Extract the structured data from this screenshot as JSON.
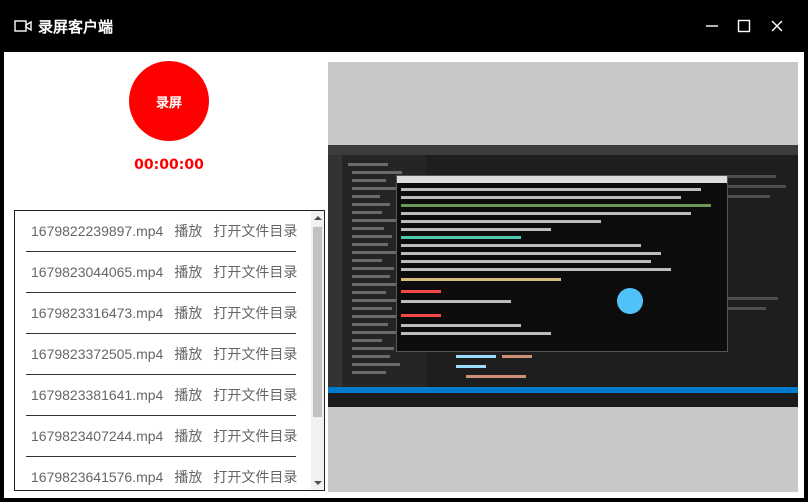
{
  "window": {
    "title": "录屏客户端"
  },
  "recorder": {
    "record_label": "录屏",
    "timer": "00:00:00"
  },
  "recordings": [
    {
      "filename": "1679822239897.mp4",
      "play": "播放",
      "open_folder": "打开文件目录"
    },
    {
      "filename": "1679823044065.mp4",
      "play": "播放",
      "open_folder": "打开文件目录"
    },
    {
      "filename": "1679823316473.mp4",
      "play": "播放",
      "open_folder": "打开文件目录"
    },
    {
      "filename": "1679823372505.mp4",
      "play": "播放",
      "open_folder": "打开文件目录"
    },
    {
      "filename": "1679823381641.mp4",
      "play": "播放",
      "open_folder": "打开文件目录"
    },
    {
      "filename": "1679823407244.mp4",
      "play": "播放",
      "open_folder": "打开文件目录"
    },
    {
      "filename": "1679823641576.mp4",
      "play": "播放",
      "open_folder": "打开文件目录"
    }
  ],
  "icons": {
    "app": "video-camera-icon",
    "minimize": "minimize-icon",
    "maximize": "maximize-icon",
    "close": "close-icon",
    "scroll_up": "chevron-up-icon",
    "scroll_down": "chevron-down-icon"
  },
  "colors": {
    "titlebar": "#000000",
    "record_button": "#ff0000",
    "timer_text": "#ff0000",
    "preview_background": "#c8c8c8"
  }
}
